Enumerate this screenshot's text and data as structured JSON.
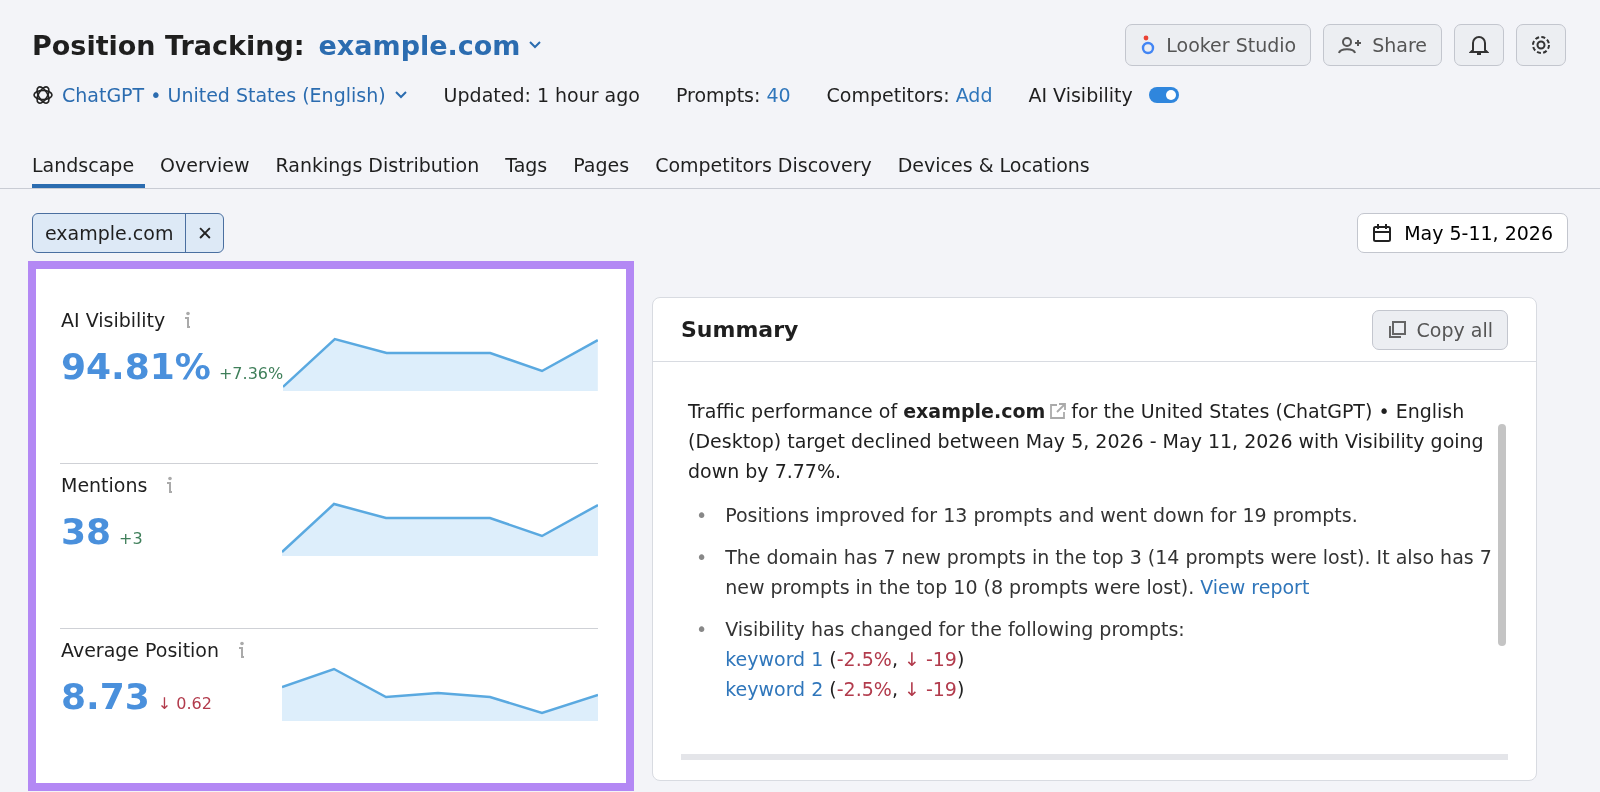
{
  "header": {
    "title": "Position Tracking:",
    "domain": "example.com",
    "buttons": [
      {
        "label": "Looker Studio",
        "kind": "looker"
      },
      {
        "label": "Share",
        "kind": "share"
      },
      {
        "kind": "bell"
      },
      {
        "kind": "gear"
      }
    ]
  },
  "meta": {
    "engine": "ChatGPT • United States (English)",
    "updated": "Updated: 1 hour ago",
    "prompts_label": "Prompts:",
    "prompts_value": "40",
    "competitors_label": "Competitors:",
    "competitors_value": "Add",
    "visibility_label": "AI Visibility",
    "visibility_on": true
  },
  "tabs": [
    {
      "label": "Landscape",
      "selected": true
    },
    {
      "label": "Overview",
      "selected": false
    },
    {
      "label": "Rankings Distribution",
      "selected": false
    },
    {
      "label": "Tags",
      "selected": false
    },
    {
      "label": "Pages",
      "selected": false
    },
    {
      "label": "Competitors Discovery",
      "selected": false
    },
    {
      "label": "Devices & Locations",
      "selected": false
    }
  ],
  "filter": {
    "chip": "example.com",
    "close": "✕"
  },
  "date": "May 5-11, 2026",
  "metrics": [
    {
      "label": "AI Visibility",
      "value": "94.81%",
      "delta": "+7.36%",
      "color": "#3f7f5a"
    },
    {
      "label": "Mentions",
      "value": "38",
      "delta": "+3",
      "color": "#3f7f5a"
    },
    {
      "label": "Average Position",
      "value": "8.73",
      "delta": "↓ 0.62",
      "color": "#b23b4c"
    }
  ],
  "summary": {
    "title": "Summary",
    "copy": "Copy all",
    "intro_before": "Traffic performance of **example.com**",
    "intro_after": "for the United States (ChatGPT) • English (Desktop) target declined between May 5, 2026 - May 11, 2026 with Visibility going down by 7.77%.",
    "bullets": [
      {
        "marker": "•",
        "text": "Positions improved for 13 prompts and went down for 19 prompts."
      },
      {
        "marker": "•",
        "text": "The domain has 7 new prompts in the top 3 (14 prompts were lost). It also has 7 new prompts in the top 10 (8 prompts were lost).",
        "link": "View report"
      },
      {
        "marker": "•",
        "text": "Visibility has changed for the following prompts:",
        "keywords": [
          {
            "name": "keyword 1",
            "parts": [
              {
                "text": "(",
                "kind": "plain"
              },
              {
                "text": "-2.5%",
                "kind": "negative"
              },
              {
                "text": ", ",
                "kind": "plain"
              },
              {
                "text": "↓ -19",
                "kind": "negative"
              },
              {
                "text": ")",
                "kind": "plain"
              }
            ]
          },
          {
            "name": "keyword 2",
            "parts": [
              {
                "text": "(",
                "kind": "plain"
              },
              {
                "text": "-2.5%",
                "kind": "negative"
              },
              {
                "text": ", ",
                "kind": "plain"
              },
              {
                "text": "↓ -19",
                "kind": "negative"
              },
              {
                "text": ")",
                "kind": "plain"
              }
            ]
          }
        ]
      }
    ]
  }
}
